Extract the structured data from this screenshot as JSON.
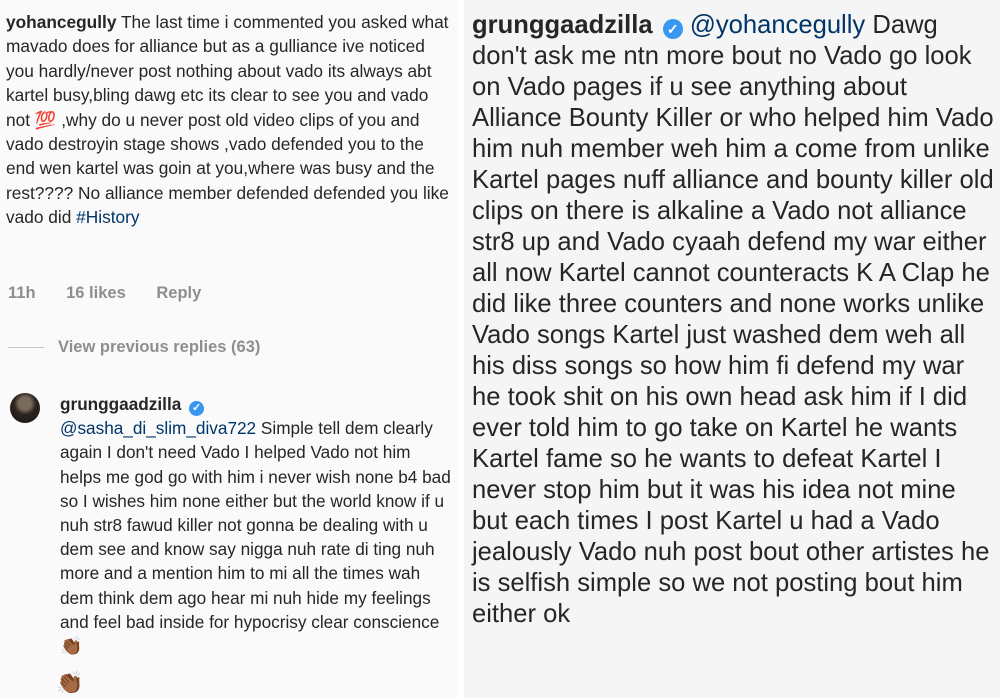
{
  "left": {
    "comment1": {
      "username": "yohancegully",
      "text_before": "The last time i commented you asked what mavado does for alliance but as a gulliance ive noticed you hardly/never post nothing about vado its always abt kartel busy,bling dawg etc its clear to see you and vado not",
      "emoji": "💯",
      "text_after": ",why do u never post old video clips of you and vado destroyin stage shows ,vado defended you to the end wen kartel was goin at you,where was busy and the rest???? No alliance  member defended defended you like vado did",
      "hashtag": "#History",
      "time": "11h",
      "likes": "16 likes",
      "reply": "Reply"
    },
    "view_replies": "View previous replies (63)",
    "comment2": {
      "username": "grunggaadzilla",
      "mention": "@sasha_di_slim_diva722",
      "text": "Simple tell dem clearly again I don't need Vado I helped Vado not him helps me god go with him i never wish none b4 bad so I wishes him none either but the world know if u nuh str8 fawud killer not gonna be dealing with u dem see and know say nigga nuh rate di ting nuh more and a mention him to mi all the times wah dem think dem ago hear mi nuh hide my feelings and feel bad inside for hypocrisy clear conscience",
      "emoji": "👏🏾"
    }
  },
  "right": {
    "comment": {
      "username": "grunggaadzilla",
      "mention": "@yohancegully",
      "text": "Dawg don't ask me ntn more bout no Vado go look on Vado pages if u see anything about Alliance Bounty Killer or who helped him Vado him nuh  member weh him a come from unlike Kartel pages nuff alliance and bounty killer old clips on there is alkaline a Vado not alliance str8 up and Vado cyaah defend my war either all now Kartel cannot counteracts K A Clap he did like three counters and none works unlike Vado songs Kartel just washed dem weh all his diss songs so how him fi defend my war he took shit on his own head ask him if I did ever told him to go take on Kartel he wants Kartel fame so he wants to defeat Kartel I never stop him but it was his idea not mine but each times I post Kartel u had a Vado jealously Vado nuh post bout other artistes he is selfish simple so we not posting bout him either ok"
    }
  },
  "icons": {
    "verified": "verified-badge-icon",
    "verified_glyph": "✓",
    "verified_color": "#3897f0",
    "mention_color": "#003569"
  }
}
